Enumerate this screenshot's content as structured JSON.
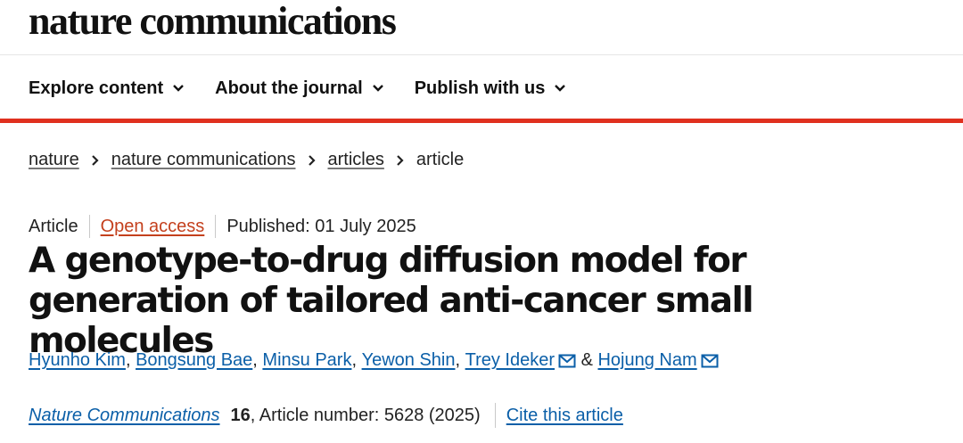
{
  "brand": "nature communications",
  "nav": {
    "items": [
      {
        "label": "Explore content"
      },
      {
        "label": "About the journal"
      },
      {
        "label": "Publish with us"
      }
    ]
  },
  "breadcrumb": {
    "items": [
      "nature",
      "nature communications",
      "articles"
    ],
    "current": "article"
  },
  "meta": {
    "type": "Article",
    "access": "Open access",
    "published": "Published: 01 July 2025"
  },
  "title": "A genotype-to-drug diffusion model for generation of tailored anti-cancer small molecules",
  "authors": {
    "list": [
      "Hyunho Kim",
      "Bongsung Bae",
      "Minsu Park",
      "Yewon Shin",
      "Trey Ideker",
      "Hojung Nam"
    ],
    "ampersand": "&",
    "comma": ","
  },
  "citation": {
    "journal": "Nature Communications",
    "volume": "16",
    "rest": ", Article number: 5628 (2025)",
    "cite_label": "Cite this article"
  },
  "colors": {
    "accent_red": "#e0301e",
    "link_blue": "#0b5fa8",
    "open_access_orange": "#c4401d"
  },
  "icons": [
    "chevron-down-icon",
    "chevron-right-icon",
    "mail-icon"
  ]
}
